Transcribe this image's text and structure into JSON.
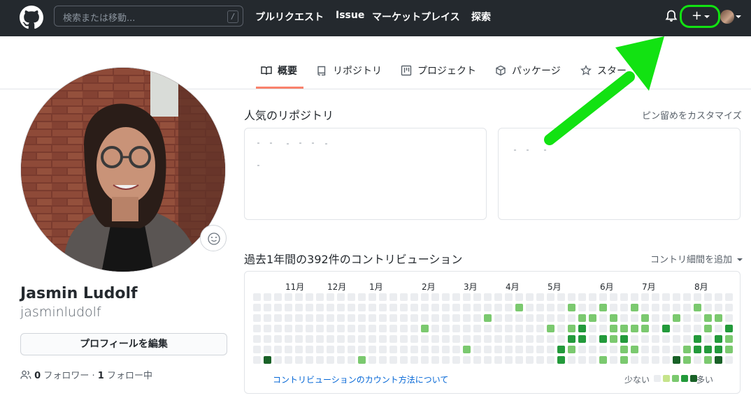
{
  "header": {
    "search_placeholder": "検索または移動...",
    "slash_key": "/",
    "nav": [
      "プルリクエスト",
      "Issue",
      "マーケットプレイス",
      "探索"
    ],
    "plus": "+"
  },
  "tabs": [
    {
      "label": "概要",
      "icon": "book-icon",
      "active": true
    },
    {
      "label": "リポジトリ",
      "icon": "repo-icon",
      "active": false
    },
    {
      "label": "プロジェクト",
      "icon": "project-icon",
      "active": false
    },
    {
      "label": "パッケージ",
      "icon": "package-icon",
      "active": false
    },
    {
      "label": "スター",
      "icon": "star-icon",
      "active": false
    }
  ],
  "profile": {
    "name": "Jasmin Ludolf",
    "login": "jasminludolf",
    "edit_label": "プロフィールを編集",
    "followers_count": "0",
    "followers_label": "フォロワー",
    "separator": "·",
    "following_count": "1",
    "following_label": "フォロー中"
  },
  "popular": {
    "title": "人気のリポジトリ",
    "customize": "ピン留めをカスタマイズ"
  },
  "contributions": {
    "title": "過去1年間の392件のコントリビューション",
    "settings": "コントリ細間を追加",
    "months": [
      "11月",
      "12月",
      "1月",
      "2月",
      "3月",
      "4月",
      "5月",
      "6月",
      "7月",
      "8月"
    ],
    "learn_link": "コントリビューションのカウント方法について",
    "legend_less": "少ない",
    "legend_more": "多い",
    "colors": [
      "#ebedf0",
      "#c6e48b",
      "#7bc96f",
      "#239a3b",
      "#196127"
    ],
    "levels": [
      "0000000000000000000000000000000000000000000000",
      "0000000000000000000002000000000000000000000000",
      "0000000000000000000000010000000000000000000000",
      "0000000000000000000000000000000000000000000000",
      "0000000000000000000000000000000000000000000000",
      "0000000000000000000000000000000000000000000000",
      "0000000000000000000000000000000000000000000000",
      "0000000000000000000000000000000000000000000000",
      "0000000000000000000000000000000000000000000000",
      "0000000000000000000000000000000000000000000000",
      "0000000000000000000000000000000000000000000000",
      "0000000000000000000000000000000000000000000000",
      "0000000000000000000000000000000000000000000000",
      "0000000000000000000000000000000000000000000000",
      "0000000000000000000000000000000000000000000000",
      "0000000000000000000000000000000000000000000000",
      "0000000000000000000000000000000000000000000000",
      "0000000000000000000000000000000000000000000000",
      "0000000000000000000000000000000000000000000000",
      "0000000000000000000000000000000000000000000000",
      "0000000000000000000000000000000000000000000000",
      "0000000000000000000000000000000000000000000000",
      "0000000000000000000000000000000000000000000000"
    ]
  }
}
